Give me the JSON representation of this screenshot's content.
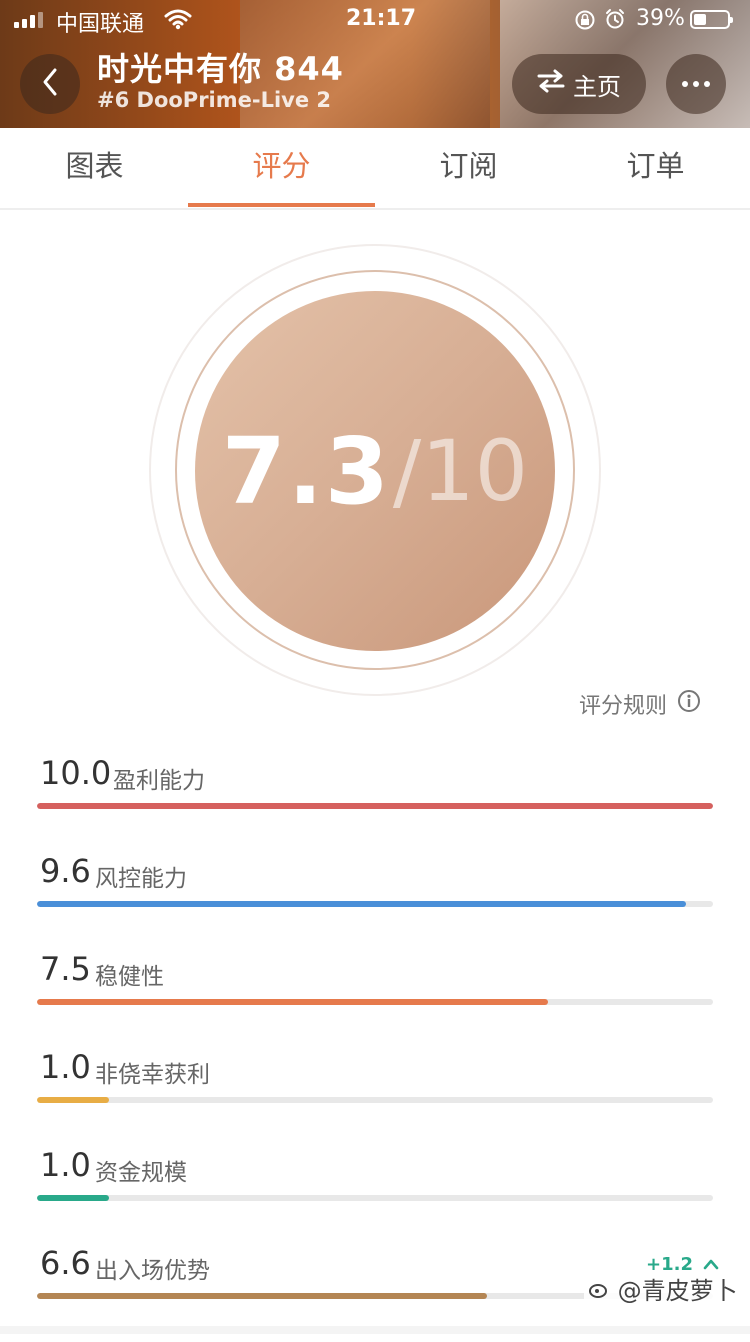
{
  "status_bar": {
    "carrier": "中国联通",
    "time": "21:17",
    "battery": "39%",
    "battery_level": 0.39
  },
  "header": {
    "title": "时光中有你 844",
    "subtitle": "#6 DooPrime-Live 2",
    "home_label": "主页"
  },
  "tabs": [
    {
      "label": "图表"
    },
    {
      "label": "评分"
    },
    {
      "label": "订阅"
    },
    {
      "label": "订单"
    }
  ],
  "active_tab": 1,
  "score": {
    "value": "7.3",
    "max": "/10",
    "rules_label": "评分规则"
  },
  "metrics": [
    {
      "value": "10.0",
      "label": "盈利能力",
      "fill": 1.0,
      "color": "#d5605e"
    },
    {
      "value": "9.6",
      "label": "风控能力",
      "fill": 0.96,
      "color": "#4a8fd8"
    },
    {
      "value": "7.5",
      "label": "稳健性",
      "fill": 0.756,
      "color": "#e67a4c"
    },
    {
      "value": "1.0",
      "label": "非侥幸获利",
      "fill": 0.107,
      "color": "#e8ad45"
    },
    {
      "value": "1.0",
      "label": "资金规模",
      "fill": 0.107,
      "color": "#29a98a"
    },
    {
      "value": "6.6",
      "label": "出入场优势",
      "fill": 0.665,
      "color": "#b48654",
      "delta": "+1.2"
    }
  ],
  "watermark": "@青皮萝卜"
}
